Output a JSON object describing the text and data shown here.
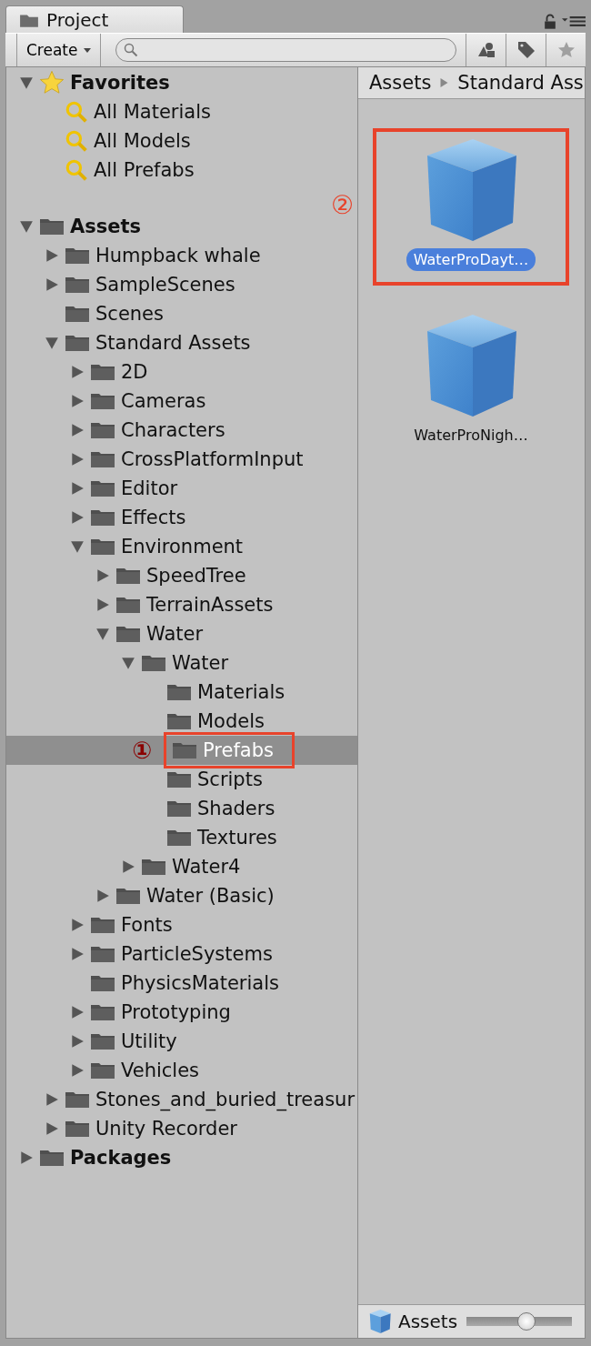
{
  "window": {
    "tab": "Project"
  },
  "toolbar": {
    "create": "Create"
  },
  "tree": [
    {
      "label": "Favorites",
      "kind": "favorites",
      "expanded": true,
      "selected": false,
      "children": [
        {
          "label": "All Materials",
          "kind": "search",
          "selected": false
        },
        {
          "label": "All Models",
          "kind": "search",
          "selected": false
        },
        {
          "label": "All Prefabs",
          "kind": "search",
          "selected": false
        }
      ]
    },
    {
      "label": "Assets",
      "kind": "folder",
      "expanded": true,
      "selected": false,
      "children": [
        {
          "label": "Humpback whale",
          "kind": "folder",
          "expanded": false,
          "selected": false
        },
        {
          "label": "SampleScenes",
          "kind": "folder",
          "expanded": false,
          "selected": false
        },
        {
          "label": "Scenes",
          "kind": "folder",
          "selected": false
        },
        {
          "label": "Standard Assets",
          "kind": "folder",
          "expanded": true,
          "selected": false,
          "children": [
            {
              "label": "2D",
              "kind": "folder",
              "expanded": false,
              "selected": false
            },
            {
              "label": "Cameras",
              "kind": "folder",
              "expanded": false,
              "selected": false
            },
            {
              "label": "Characters",
              "kind": "folder",
              "expanded": false,
              "selected": false
            },
            {
              "label": "CrossPlatformInput",
              "kind": "folder",
              "expanded": false,
              "selected": false
            },
            {
              "label": "Editor",
              "kind": "folder",
              "expanded": false,
              "selected": false
            },
            {
              "label": "Effects",
              "kind": "folder",
              "expanded": false,
              "selected": false
            },
            {
              "label": "Environment",
              "kind": "folder",
              "expanded": true,
              "selected": false,
              "children": [
                {
                  "label": "SpeedTree",
                  "kind": "folder",
                  "expanded": false,
                  "selected": false
                },
                {
                  "label": "TerrainAssets",
                  "kind": "folder",
                  "expanded": false,
                  "selected": false
                },
                {
                  "label": "Water",
                  "kind": "folder",
                  "expanded": true,
                  "selected": false,
                  "children": [
                    {
                      "label": "Water",
                      "kind": "folder",
                      "expanded": true,
                      "selected": false,
                      "children": [
                        {
                          "label": "Materials",
                          "kind": "folder",
                          "selected": false
                        },
                        {
                          "label": "Models",
                          "kind": "folder",
                          "selected": false
                        },
                        {
                          "label": "Prefabs",
                          "kind": "folder",
                          "selected": true,
                          "marker": "①"
                        },
                        {
                          "label": "Scripts",
                          "kind": "folder",
                          "selected": false
                        },
                        {
                          "label": "Shaders",
                          "kind": "folder",
                          "selected": false
                        },
                        {
                          "label": "Textures",
                          "kind": "folder",
                          "selected": false
                        }
                      ]
                    },
                    {
                      "label": "Water4",
                      "kind": "folder",
                      "expanded": false,
                      "selected": false
                    }
                  ]
                },
                {
                  "label": "Water (Basic)",
                  "kind": "folder",
                  "expanded": false,
                  "selected": false
                }
              ]
            },
            {
              "label": "Fonts",
              "kind": "folder",
              "expanded": false,
              "selected": false
            },
            {
              "label": "ParticleSystems",
              "kind": "folder",
              "expanded": false,
              "selected": false
            },
            {
              "label": "PhysicsMaterials",
              "kind": "folder",
              "selected": false
            },
            {
              "label": "Prototyping",
              "kind": "folder",
              "expanded": false,
              "selected": false
            },
            {
              "label": "Utility",
              "kind": "folder",
              "expanded": false,
              "selected": false
            },
            {
              "label": "Vehicles",
              "kind": "folder",
              "expanded": false,
              "selected": false
            }
          ]
        },
        {
          "label": "Stones_and_buried_treasur",
          "kind": "folder",
          "expanded": false,
          "selected": false
        },
        {
          "label": "Unity Recorder",
          "kind": "folder",
          "expanded": false,
          "selected": false
        }
      ]
    },
    {
      "label": "Packages",
      "kind": "folder",
      "expanded": false,
      "selected": false
    }
  ],
  "breadcrumb": [
    "Assets",
    "Standard Ass"
  ],
  "assets": [
    {
      "label": "WaterProDayt…",
      "selected": true,
      "marker": "②"
    },
    {
      "label": "WaterProNigh…",
      "selected": false
    }
  ],
  "footer": {
    "label": "Assets",
    "zoom": {
      "level": 0.58
    }
  }
}
